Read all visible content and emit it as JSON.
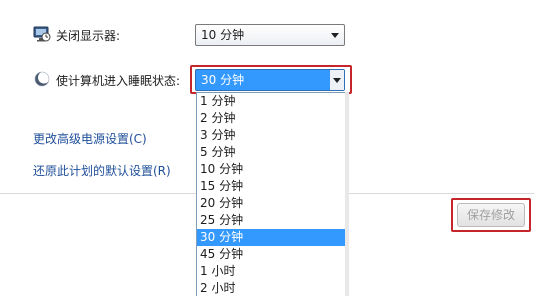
{
  "settings": {
    "display": {
      "label": "关闭显示器:",
      "value": "10 分钟",
      "icon": "monitor-icon"
    },
    "sleep": {
      "label": "使计算机进入睡眠状态:",
      "value": "30 分钟",
      "icon": "moon-icon"
    }
  },
  "links": {
    "advanced": "更改高级电源设置(C)",
    "restore": "还原此计划的默认设置(R)"
  },
  "save_button": "保存修改",
  "dropdown": {
    "options": [
      "1 分钟",
      "2 分钟",
      "3 分钟",
      "5 分钟",
      "10 分钟",
      "15 分钟",
      "20 分钟",
      "25 分钟",
      "30 分钟",
      "45 分钟",
      "1 小时",
      "2 小时"
    ],
    "selected": "30 分钟"
  },
  "colors": {
    "highlight_red": "#c4262b",
    "selection_blue": "#3399ff",
    "link_blue": "#1f4e99"
  }
}
